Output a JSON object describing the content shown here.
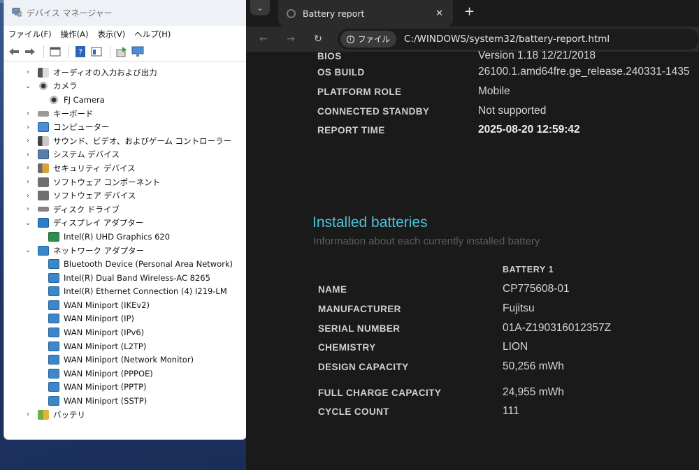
{
  "device_manager": {
    "title": "デバイス マネージャー",
    "menu": [
      "ファイル(F)",
      "操作(A)",
      "表示(V)",
      "ヘルプ(H)"
    ],
    "tree": [
      {
        "type": "cat",
        "expanded": false,
        "label": "オーディオの入力および出力",
        "icon": "audio-icon"
      },
      {
        "type": "cat",
        "expanded": true,
        "label": "カメラ",
        "icon": "camera-icon"
      },
      {
        "type": "dev",
        "label": "FJ Camera",
        "icon": "camera-icon"
      },
      {
        "type": "cat",
        "expanded": false,
        "label": "キーボード",
        "icon": "keyboard-icon"
      },
      {
        "type": "cat",
        "expanded": false,
        "label": "コンピューター",
        "icon": "computer-icon"
      },
      {
        "type": "cat",
        "expanded": false,
        "label": "サウンド、ビデオ、およびゲーム コントローラー",
        "icon": "sound-icon"
      },
      {
        "type": "cat",
        "expanded": false,
        "label": "システム デバイス",
        "icon": "system-icon"
      },
      {
        "type": "cat",
        "expanded": false,
        "label": "セキュリティ デバイス",
        "icon": "security-icon"
      },
      {
        "type": "cat",
        "expanded": false,
        "label": "ソフトウェア コンポーネント",
        "icon": "software-icon"
      },
      {
        "type": "cat",
        "expanded": false,
        "label": "ソフトウェア デバイス",
        "icon": "software-icon"
      },
      {
        "type": "cat",
        "expanded": false,
        "label": "ディスク ドライブ",
        "icon": "disk-icon"
      },
      {
        "type": "cat",
        "expanded": true,
        "label": "ディスプレイ アダプター",
        "icon": "display-icon"
      },
      {
        "type": "dev",
        "label": "Intel(R) UHD Graphics 620",
        "icon": "gpu-icon"
      },
      {
        "type": "cat",
        "expanded": true,
        "label": "ネットワーク アダプター",
        "icon": "network-icon"
      },
      {
        "type": "dev",
        "label": "Bluetooth Device (Personal Area Network)",
        "icon": "network-icon"
      },
      {
        "type": "dev",
        "label": "Intel(R) Dual Band Wireless-AC 8265",
        "icon": "network-icon"
      },
      {
        "type": "dev",
        "label": "Intel(R) Ethernet Connection (4) I219-LM",
        "icon": "network-icon"
      },
      {
        "type": "dev",
        "label": "WAN Miniport (IKEv2)",
        "icon": "network-icon"
      },
      {
        "type": "dev",
        "label": "WAN Miniport (IP)",
        "icon": "network-icon"
      },
      {
        "type": "dev",
        "label": "WAN Miniport (IPv6)",
        "icon": "network-icon"
      },
      {
        "type": "dev",
        "label": "WAN Miniport (L2TP)",
        "icon": "network-icon"
      },
      {
        "type": "dev",
        "label": "WAN Miniport (Network Monitor)",
        "icon": "network-icon"
      },
      {
        "type": "dev",
        "label": "WAN Miniport (PPPOE)",
        "icon": "network-icon"
      },
      {
        "type": "dev",
        "label": "WAN Miniport (PPTP)",
        "icon": "network-icon"
      },
      {
        "type": "dev",
        "label": "WAN Miniport (SSTP)",
        "icon": "network-icon"
      },
      {
        "type": "cat",
        "expanded": false,
        "label": "バッテリ",
        "icon": "battery-icon"
      }
    ]
  },
  "browser": {
    "tab_title": "Battery report",
    "address_chip": "ファイル",
    "url": "C:/WINDOWS/system32/battery-report.html",
    "system_info": [
      {
        "key": "BIOS",
        "value": "Version 1.18 12/21/2018",
        "bold": false
      },
      {
        "key": "OS BUILD",
        "value": "26100.1.amd64fre.ge_release.240331-1435",
        "bold": false
      },
      {
        "key": "PLATFORM ROLE",
        "value": "Mobile",
        "bold": false
      },
      {
        "key": "CONNECTED STANDBY",
        "value": "Not supported",
        "bold": false
      },
      {
        "key": "REPORT TIME",
        "value": "2025-08-20  12:59:42",
        "bold": true
      }
    ],
    "section_title": "Installed batteries",
    "section_subtitle": "Information about each currently installed battery",
    "battery_header": "BATTERY 1",
    "battery_rows": [
      {
        "key": "NAME",
        "value": "CP775608-01"
      },
      {
        "key": "MANUFACTURER",
        "value": "Fujitsu"
      },
      {
        "key": "SERIAL NUMBER",
        "value": "01A-Z190316012357Z"
      },
      {
        "key": "CHEMISTRY",
        "value": "LION"
      },
      {
        "key": "DESIGN CAPACITY",
        "value": "50,256 mWh"
      },
      {
        "key": "FULL CHARGE CAPACITY",
        "value": "24,955 mWh"
      },
      {
        "key": "CYCLE COUNT",
        "value": "111"
      }
    ]
  }
}
